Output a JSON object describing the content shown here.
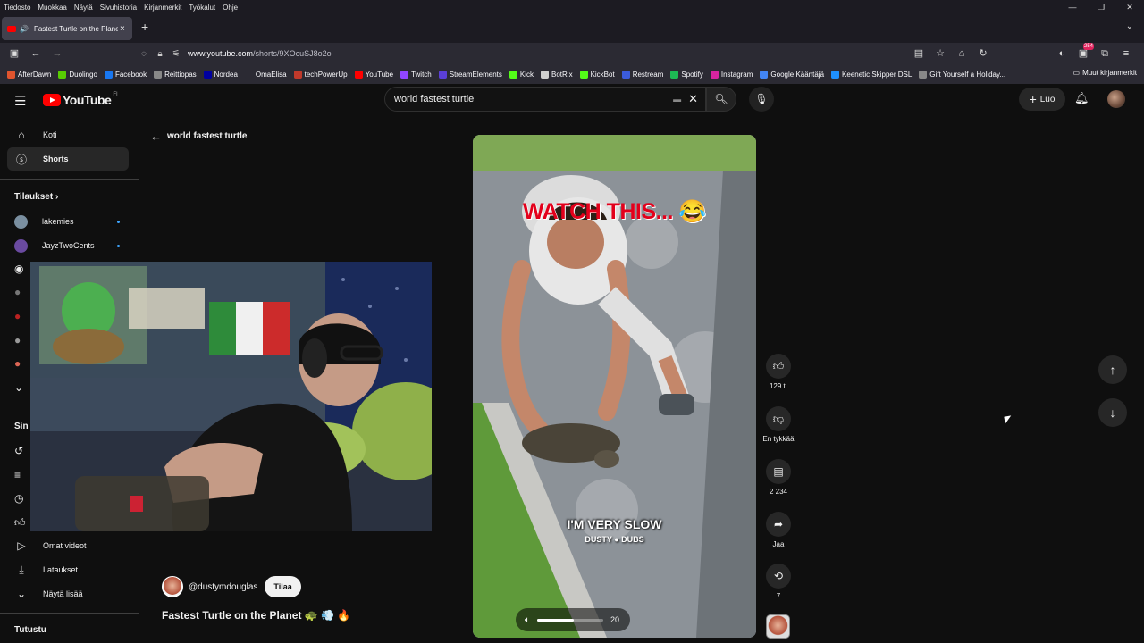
{
  "os_menu": [
    "Tiedosto",
    "Muokkaa",
    "Näytä",
    "Sivuhistoria",
    "Kirjanmerkit",
    "Työkalut",
    "Ohje"
  ],
  "browser": {
    "tab_title": "Fastest Turtle on the Planet",
    "url_host": "www.youtube.com",
    "url_path": "/shorts/9XOcuSJ8o2o",
    "extension_badge": "254"
  },
  "bookmarks": [
    {
      "label": "AfterDawn",
      "color": "#e0542e"
    },
    {
      "label": "Duolingo",
      "color": "#58cc02"
    },
    {
      "label": "Facebook",
      "color": "#1877f2"
    },
    {
      "label": "Reittiopas",
      "color": "#888888"
    },
    {
      "label": "Nordea",
      "color": "#0000a0"
    },
    {
      "label": "OmaElisa",
      "color": "#2b2a33"
    },
    {
      "label": "techPowerUp",
      "color": "#c0392b"
    },
    {
      "label": "YouTube",
      "color": "#ff0000"
    },
    {
      "label": "Twitch",
      "color": "#9146ff"
    },
    {
      "label": "StreamElements",
      "color": "#5a3fd6"
    },
    {
      "label": "Kick",
      "color": "#53fc18"
    },
    {
      "label": "BotRix",
      "color": "#d0d0d0"
    },
    {
      "label": "KickBot",
      "color": "#53fc18"
    },
    {
      "label": "Restream",
      "color": "#3b5bdb"
    },
    {
      "label": "Spotify",
      "color": "#1db954"
    },
    {
      "label": "Instagram",
      "color": "#d6249f"
    },
    {
      "label": "Google Kääntäjä",
      "color": "#4285f4"
    },
    {
      "label": "Keenetic Skipper DSL",
      "color": "#1e90ff"
    },
    {
      "label": "Gift Yourself a Holiday...",
      "color": "#888888"
    }
  ],
  "bookmarks_other": "Muut kirjanmerkit",
  "yt": {
    "logo_text": "YouTube",
    "logo_region": "FI",
    "search_query": "world fastest turtle",
    "create_label": "Luo"
  },
  "sidebar": {
    "home": "Koti",
    "shorts": "Shorts",
    "subscriptions_head": "Tilaukset",
    "subs": [
      {
        "name": "lakemies",
        "color": "#7a8fa0"
      },
      {
        "name": "JayzTwoCents",
        "color": "#6a4aa0"
      }
    ],
    "you_head_partial": "Sin",
    "own_videos": "Omat videot",
    "downloads": "Lataukset",
    "show_more": "Näytä lisää",
    "explore_head": "Tutustu"
  },
  "back_label": "world fastest turtle",
  "channel": {
    "handle": "@dustymdouglas",
    "subscribe_label": "Tilaa"
  },
  "short_title": "Fastest Turtle on the Planet 🐢 💨 🔥",
  "video": {
    "caption_top": "WATCH THIS... 😂",
    "caption_mid": "I'M VERY SLOW",
    "brand": "DUSTY ● DUBS",
    "volume": 20,
    "volume_fraction": 0.55
  },
  "actions": {
    "likes": "129 t.",
    "dislike": "En tykkää",
    "comments": "2 234",
    "share": "Jaa",
    "remix": "7"
  }
}
